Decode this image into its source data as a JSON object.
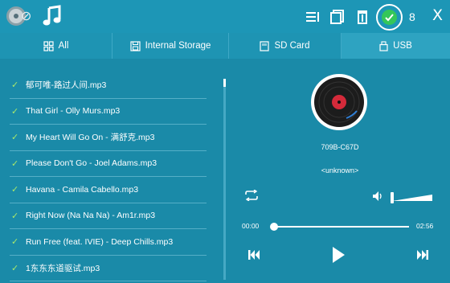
{
  "toolbar": {
    "app_icon": "player-app-icon",
    "music_icon": "music-note-icon",
    "sort_icon": "sort-list-icon",
    "multiselect_icon": "copy-layers-icon",
    "delete_icon": "trash-icon",
    "select_all_icon": "check-circle-icon",
    "selected_count": "8",
    "close_label": "X"
  },
  "tabs": [
    {
      "label": "All",
      "icon": "grid-icon",
      "active": false
    },
    {
      "label": "Internal Storage",
      "icon": "floppy-disk-icon",
      "active": false
    },
    {
      "label": "SD Card",
      "icon": "sd-card-icon",
      "active": false
    },
    {
      "label": "USB",
      "icon": "usb-drive-icon",
      "active": true
    }
  ],
  "files": [
    {
      "name": "郁可唯-路过人间.mp3",
      "checked": true
    },
    {
      "name": "That Girl - Olly Murs.mp3",
      "checked": true
    },
    {
      "name": "My Heart Will Go On - 满舒克.mp3",
      "checked": true
    },
    {
      "name": "Please Don't Go - Joel Adams.mp3",
      "checked": true
    },
    {
      "name": "Havana - Camila Cabello.mp3",
      "checked": true
    },
    {
      "name": "Right Now (Na Na Na) - Am1r.mp3",
      "checked": true
    },
    {
      "name": "Run Free (feat. IVIE) - Deep Chills.mp3",
      "checked": true
    },
    {
      "name": "1东东东道驱试.mp3",
      "checked": true
    }
  ],
  "player": {
    "title": "709B-C67D",
    "artist": "<unknown>",
    "current_time": "00:00",
    "total_time": "02:56",
    "progress": 0.0,
    "volume": 1.0
  },
  "colors": {
    "background": "#1a8aa8",
    "toolbar": "#1d96b6",
    "active_tab": "#2ea3c1",
    "check_green": "#34c759",
    "list_check": "#a8e86b"
  }
}
